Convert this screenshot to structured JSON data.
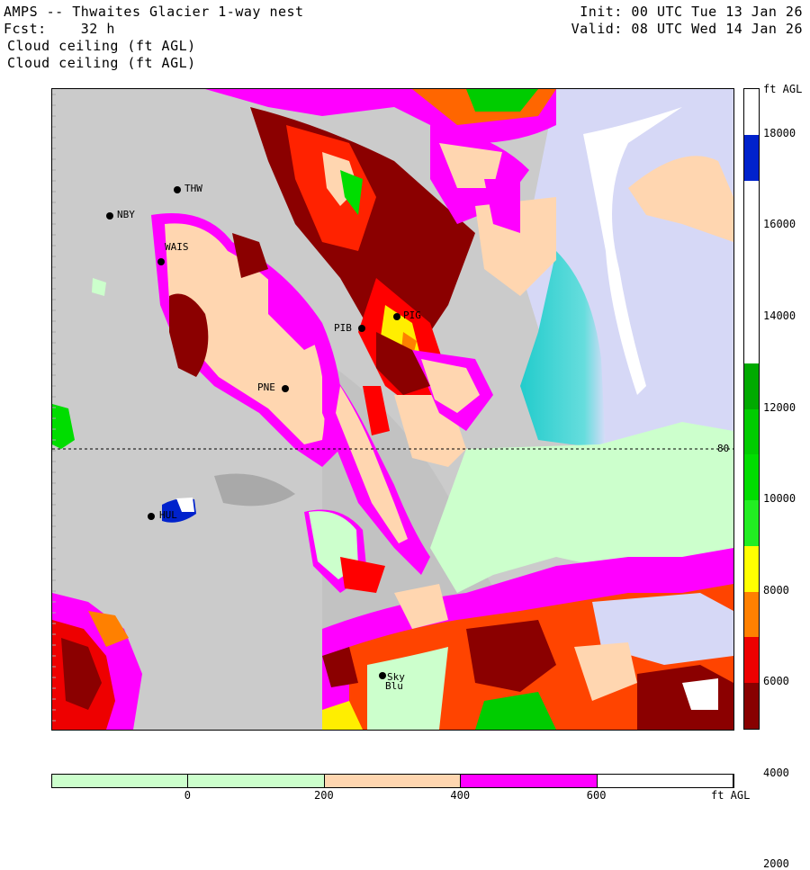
{
  "header": {
    "title": "AMPS -- Thwaites Glacier 1-way nest",
    "fcst": "Fcst:    32 h",
    "field1": "Cloud ceiling (ft AGL)",
    "field2": "Cloud ceiling (ft AGL)",
    "init": "Init: 00 UTC Tue 13 Jan 26",
    "valid": "Valid: 08 UTC Wed 14 Jan 26"
  },
  "map": {
    "stations": [
      {
        "name": "THW"
      },
      {
        "name": "NBY"
      },
      {
        "name": "WAIS"
      },
      {
        "name": "PIB"
      },
      {
        "name": "PIG"
      },
      {
        "name": "PNE"
      },
      {
        "name": "HUL"
      },
      {
        "name": "Sky"
      },
      {
        "name": "Blu"
      }
    ],
    "latitude_label": "80 W"
  },
  "colorbar_right": {
    "unit": "ft AGL",
    "ticks": [
      "18000",
      "16000",
      "14000",
      "12000",
      "10000",
      "8000",
      "6000",
      "4000",
      "2000"
    ],
    "colors": [
      "#ffffff",
      "#0022cc",
      "#ffffff",
      "#ffffff",
      "#ffffff",
      "#ffffff",
      "#00aa00",
      "#00cc00",
      "#00dd00",
      "#22ee22",
      "#ffff00",
      "#ff8000",
      "#ee0000",
      "#880000"
    ]
  },
  "colorbar_bottom": {
    "unit": "ft AGL",
    "ticks": [
      "0",
      "200",
      "400",
      "600"
    ],
    "colors": [
      "#ccffcc",
      "#ccffcc",
      "#ffd6b0",
      "#ff00ff",
      "#ffffff"
    ]
  }
}
